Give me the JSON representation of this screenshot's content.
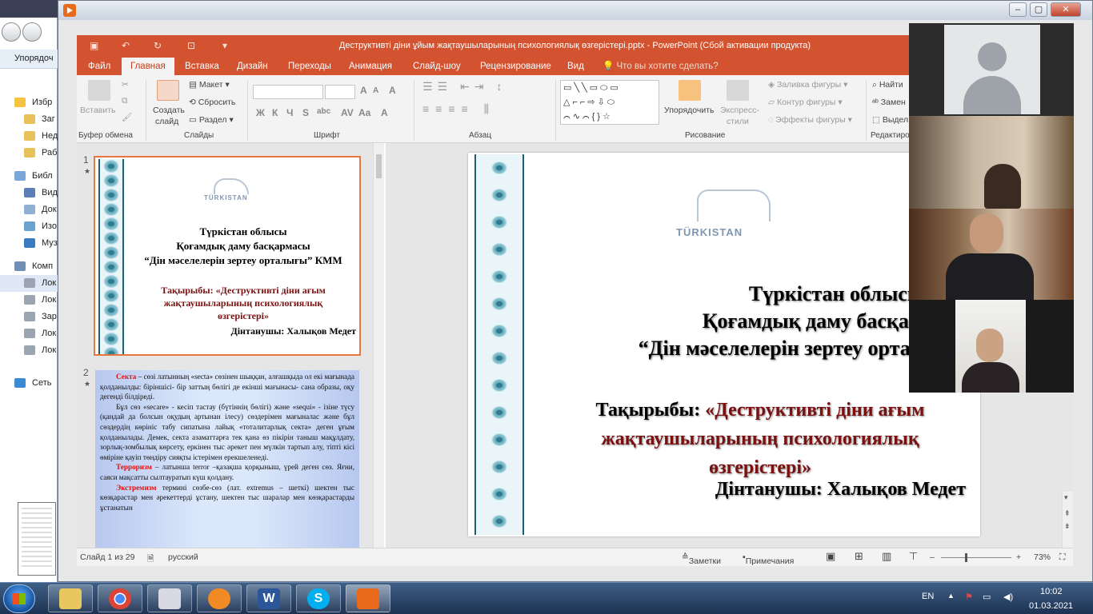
{
  "player": {
    "title": ""
  },
  "explorer": {
    "organize": "Упорядоч",
    "items": [
      {
        "label": "Избр",
        "icon": "star-icon"
      },
      {
        "label": "Заг",
        "icon": "folder-icon"
      },
      {
        "label": "Нед",
        "icon": "folder-icon"
      },
      {
        "label": "Раб",
        "icon": "folder-icon"
      },
      {
        "label": "Библ",
        "icon": "library-icon"
      },
      {
        "label": "Вид",
        "icon": "video-icon"
      },
      {
        "label": "Док",
        "icon": "document-icon"
      },
      {
        "label": "Изо",
        "icon": "image-icon"
      },
      {
        "label": "Муз",
        "icon": "music-icon"
      },
      {
        "label": "Комп",
        "icon": "computer-icon"
      },
      {
        "label": "Лок",
        "icon": "drive-icon"
      },
      {
        "label": "Лок",
        "icon": "drive-icon"
      },
      {
        "label": "Зар",
        "icon": "drive-icon"
      },
      {
        "label": "Лок",
        "icon": "drive-icon"
      },
      {
        "label": "Лок",
        "icon": "drive-icon"
      },
      {
        "label": "Сеть",
        "icon": "network-icon"
      }
    ]
  },
  "ppt": {
    "doc_title": "Деструктивті діни ұйым жақтаушыларының психологиялық өзгерістері.pptx - PowerPoint (Сбой активации продукта)",
    "tabs": [
      "Файл",
      "Главная",
      "Вставка",
      "Дизайн",
      "Переходы",
      "Анимация",
      "Слайд-шоу",
      "Рецензирование",
      "Вид",
      "Что вы хотите сделать?"
    ],
    "ribbon": {
      "paste": "Вставить",
      "clipboard_group": "Буфер обмена",
      "new_slide_1": "Создать",
      "new_slide_2": "слайд",
      "layout": "Макет",
      "reset": "Сбросить",
      "section": "Раздел",
      "slides_group": "Слайды",
      "font_group": "Шрифт",
      "paragraph_group": "Абзац",
      "arrange": "Упорядочить",
      "quick_styles_1": "Экспресс-",
      "quick_styles_2": "стили",
      "fill": "Заливка фигуры",
      "outline": "Контур фигуры",
      "effects": "Эффекты фигуры",
      "drawing_group": "Рисование",
      "find": "Найти",
      "replace": "Замен",
      "select": "Выдел",
      "editing_group": "Редактиров",
      "font_buttons": [
        "Ж",
        "К",
        "Ч",
        "S",
        "abc",
        "AV",
        "Aa",
        "A"
      ],
      "shape_glyphs": "▭╲╲▭⬭▭ △⌐⌐⇨⇩⬭ ⌒∿⌒{}☆"
    },
    "slide": {
      "logo": "TÜRKISTAN",
      "line1": "Түркістан облысы",
      "line2": "Қоғамдық даму басқармасы",
      "line3": "“Дін мәселелерін зертеу орталығы” КММ",
      "topic1": "Тақырыбы: «Деструктивті діни ағым",
      "topic2": "жақтаушыларының психологиялық",
      "topic3": "өзгерістері»",
      "author": "Дінтанушы: Халықов Медет"
    },
    "thumb2": {
      "p1_lead": "Секта",
      "p1": " – сөзі латынның «secta» сөзінен шыққан, алғашқыда ол екі мағынада қолданылды: біріншісі- бір заттың бөлігі де екінші мағынасы- сана образы, оқу дегенді білдіреді.",
      "p2": "Бұл сөз «secare» - кесіп тастау (бүтіннің бөлігі) және «sequi» - ізіне түсу (қандай да болсын оқудың артынан ілесу) сөздерімен мағыналас және бұл сөздердің көрініс табу сипатына лайық «тоталитарлық секта» деген ұғым қолданылады. Демек, секта азаматтарға тек қана өз пікірін таныш мақұлдату, зорлық-зомбылық көрсету, еркінен тыс әрекет пен мүлкін тартып алу, тіпті кісі өміріне қауіп төндіру сияқты істерімен ерекшеленеді.",
      "p3_lead": "Терроризм",
      "p3": " – латынша terror –қазақша қорқыныш, үрей деген сөз. Яғни, саяси мақсатты сылтауратып күш қолдану.",
      "p4_lead": "Экстремизм",
      "p4": " термині сөзбе-сөз (лат. extremus – шеткі) шектен тыс көзқарастар мен әрекеттерді ұстану, шектен тыс шаралар мен көзқарастарды ұстанатын"
    },
    "thumb_numbers": [
      "1",
      "2"
    ],
    "status": {
      "slide": "Слайд 1 из 29",
      "lang": "русский",
      "notes": "Заметки",
      "comments": "Примечания",
      "zoom": "73%"
    }
  },
  "taskbar": {
    "apps": [
      {
        "name": "explorer",
        "icon": "folder-icon"
      },
      {
        "name": "chrome",
        "icon": "chrome-icon"
      },
      {
        "name": "paint",
        "icon": "scissors-icon"
      },
      {
        "name": "browser",
        "icon": "browser-e-icon"
      },
      {
        "name": "word",
        "icon": "word-icon",
        "glyph": "W"
      },
      {
        "name": "skype",
        "icon": "skype-icon",
        "glyph": "S"
      },
      {
        "name": "player",
        "icon": "player-icon"
      }
    ],
    "lang": "EN",
    "time": "10:02",
    "date": "01.03.2021"
  },
  "colors": {
    "accent": "#d35230",
    "taskbar": "#1d3252"
  }
}
